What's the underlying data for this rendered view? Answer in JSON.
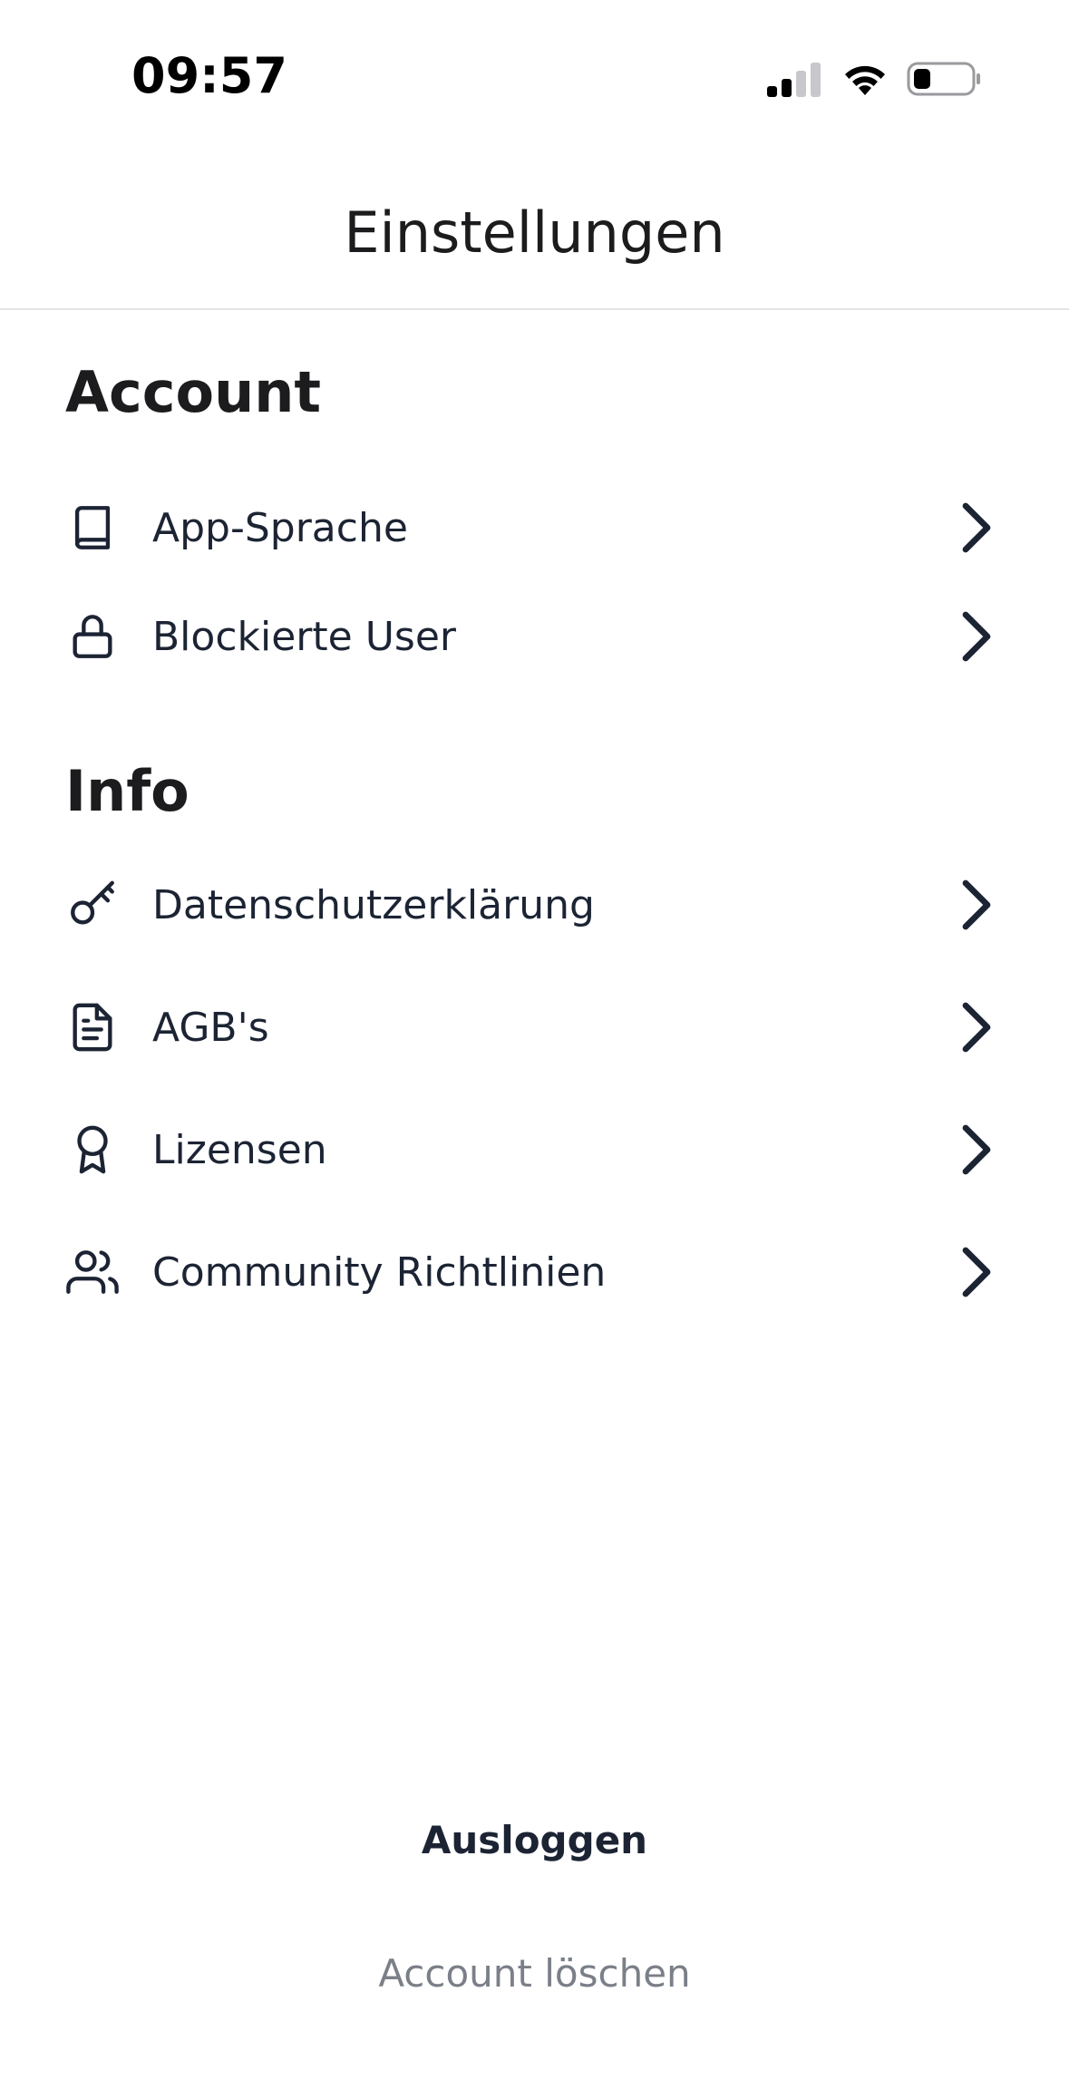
{
  "status_bar": {
    "time": "09:57",
    "icons": [
      "cellular-signal-icon",
      "wifi-icon",
      "battery-icon"
    ]
  },
  "header": {
    "title": "Einstellungen",
    "back_icon": "chevron-left-icon"
  },
  "sections": [
    {
      "heading": "Account",
      "items": [
        {
          "label": "App-Sprache",
          "icon": "book-icon"
        },
        {
          "label": "Blockierte User",
          "icon": "lock-icon"
        }
      ]
    },
    {
      "heading": "Info",
      "items": [
        {
          "label": "Datenschutzerklärung",
          "icon": "key-icon"
        },
        {
          "label": "AGB's",
          "icon": "document-icon"
        },
        {
          "label": "Lizensen",
          "icon": "award-icon"
        },
        {
          "label": "Community Richtlinien",
          "icon": "users-icon"
        }
      ]
    }
  ],
  "actions": {
    "logout_label": "Ausloggen",
    "delete_account_label": "Account löschen"
  },
  "colors": {
    "text_primary": "#1c2434",
    "text_muted": "#7a7f88",
    "divider": "#e5e5e5"
  }
}
